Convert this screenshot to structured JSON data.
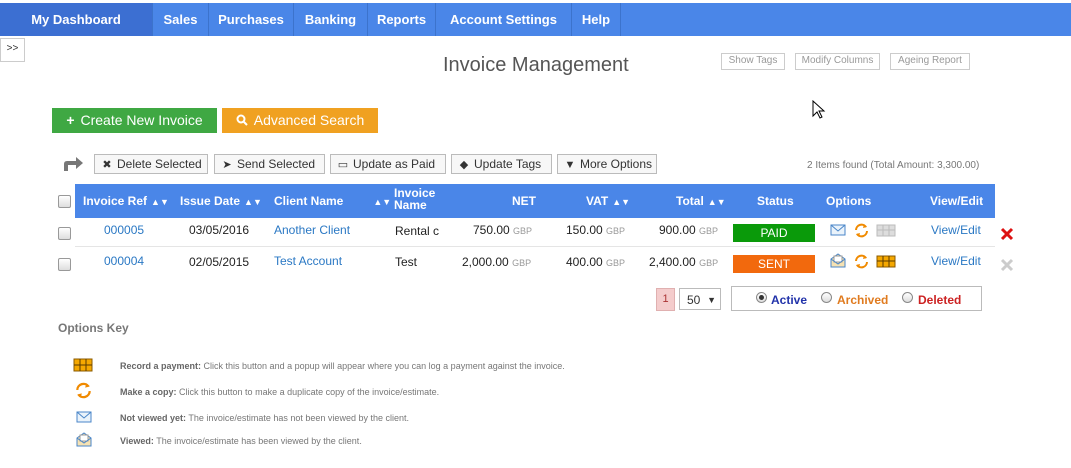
{
  "nav": {
    "items": [
      "My Dashboard",
      "Sales",
      "Purchases",
      "Banking",
      "Reports",
      "Account Settings",
      "Help"
    ]
  },
  "sidebar_toggle": ">>",
  "page_title": "Invoice Management",
  "top_links": {
    "show_tags": "Show Tags",
    "modify_columns": "Modify Columns",
    "ageing_report": "Ageing Report"
  },
  "actions": {
    "create": "Create New Invoice",
    "search": "Advanced Search"
  },
  "toolbar": {
    "delete_selected": "Delete Selected",
    "send_selected": "Send Selected",
    "update_as_paid": "Update as Paid",
    "update_tags": "Update Tags",
    "more_options": "More Options",
    "items_found": "2 Items found (Total Amount: 3,300.00)"
  },
  "table": {
    "headers": {
      "invoice_ref": "Invoice Ref",
      "issue_date": "Issue Date",
      "client_name": "Client Name",
      "invoice_name_1": "Invoice",
      "invoice_name_2": "Name",
      "net": "NET",
      "vat": "VAT",
      "total": "Total",
      "status": "Status",
      "options": "Options",
      "view_edit": "View/Edit"
    },
    "currency": "GBP",
    "rows": [
      {
        "ref": "000005",
        "date": "03/05/2016",
        "client": "Another Client",
        "name": "Rental c",
        "net": "750.00",
        "vat": "150.00",
        "total": "900.00",
        "status": "PAID",
        "status_color": "#0a9a0a",
        "view": "View/Edit",
        "viewed": false
      },
      {
        "ref": "000004",
        "date": "02/05/2015",
        "client": "Test Account",
        "name": "Test",
        "net": "2,000.00",
        "vat": "400.00",
        "total": "2,400.00",
        "status": "SENT",
        "status_color": "#f2690d",
        "view": "View/Edit",
        "viewed": true
      }
    ]
  },
  "pagination": {
    "page": "1",
    "per_page": "50"
  },
  "filter": {
    "active": "Active",
    "archived": "Archived",
    "deleted": "Deleted",
    "active_color": "#2233aa",
    "archived_color": "#e07b1f",
    "deleted_color": "#cc2222"
  },
  "options_key": {
    "title": "Options Key",
    "items": [
      {
        "label": "Record a payment:",
        "text": " Click this button and a popup will appear where you can log a payment against the invoice."
      },
      {
        "label": "Make a copy:",
        "text": " Click this button to make a duplicate copy of the invoice/estimate."
      },
      {
        "label": "Not viewed yet:",
        "text": " The invoice/estimate has not been viewed by the client."
      },
      {
        "label": "Viewed:",
        "text": " The invoice/estimate has been viewed by the client."
      }
    ]
  }
}
